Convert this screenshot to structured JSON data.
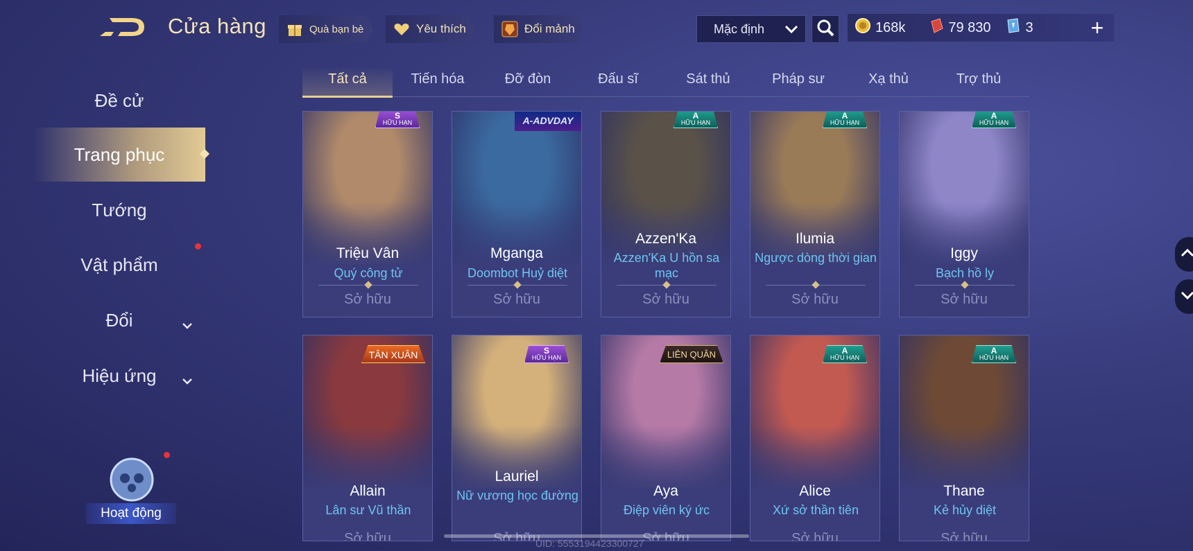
{
  "header": {
    "title": "Cửa hàng",
    "gift_label": "Quà bạn bè",
    "fav_label": "Yêu thích",
    "exchange_label": "Đổi mảnh",
    "sort_value": "Mặc định",
    "gold": "168k",
    "vouchers": "79 830",
    "diamonds": "3",
    "plus": "+"
  },
  "sidebar": {
    "items": [
      {
        "label": "Đề cử"
      },
      {
        "label": "Trang phục"
      },
      {
        "label": "Tướng"
      },
      {
        "label": "Vật phẩm"
      },
      {
        "label": "Đổi"
      },
      {
        "label": "Hiệu ứng"
      }
    ],
    "activity": "Hoạt động"
  },
  "tabs": [
    "Tất cả",
    "Tiến hóa",
    "Đỡ đòn",
    "Đấu sĩ",
    "Sát thủ",
    "Pháp sư",
    "Xạ thủ",
    "Trợ thủ"
  ],
  "cards": [
    {
      "hero": "Triệu Vân",
      "skin": "Quý công tử",
      "owned": "Sở hữu",
      "badge_tier": "S",
      "badge_text": "HỮU HẠN",
      "art": "#b08a6a"
    },
    {
      "hero": "Mganga",
      "skin": "Doombot Huỷ diệt",
      "owned": "Sở hữu",
      "top_badge": "A-ADVDAY",
      "art": "#3b6aa0"
    },
    {
      "hero": "Azzen'Ka",
      "skin": "Azzen'Ka U hồn sa mạc",
      "owned": "Sở hữu",
      "badge_tier": "A",
      "badge_text": "HỮU HẠN",
      "art": "#5a5248"
    },
    {
      "hero": "Ilumia",
      "skin": "Ngược dòng thời gian",
      "owned": "Sở hữu",
      "badge_tier": "A",
      "badge_text": "HỮU HẠN",
      "art": "#9a7b58"
    },
    {
      "hero": "Iggy",
      "skin": "Bạch hồ ly",
      "owned": "Sở hữu",
      "badge_tier": "A",
      "badge_text": "HỮU HẠN",
      "art": "#8f86c8"
    },
    {
      "hero": "Allain",
      "skin": "Lân sư Vũ thần",
      "owned": "Sở hữu",
      "badge_label": "TÂN XUÂN",
      "art": "#8a3a3e"
    },
    {
      "hero": "Lauriel",
      "skin": "Nữ vương học đường",
      "owned": "Sở hữu",
      "badge_tier": "S",
      "badge_text": "HỮU HẠN",
      "art": "#d4b07a"
    },
    {
      "hero": "Aya",
      "skin": "Điệp viên ký ức",
      "owned": "Sở hữu",
      "badge_label": "LIÊN QUÂN",
      "art": "#b67aa6"
    },
    {
      "hero": "Alice",
      "skin": "Xứ sở thần tiên",
      "owned": "Sở hữu",
      "badge_tier": "A",
      "badge_text": "HỮU HẠN",
      "art": "#c25a52"
    },
    {
      "hero": "Thane",
      "skin": "Kẻ hủy diệt",
      "owned": "Sở hữu",
      "badge_tier": "A",
      "badge_text": "HỮU HẠN",
      "art": "#6e4a36"
    }
  ],
  "uid": "UID: 5553194423300727",
  "colors": {
    "gold_text": "#f3e3b8",
    "skin_text": "#6fc4f2",
    "accent": "#e8cf95",
    "red_dot": "#e8333a"
  }
}
